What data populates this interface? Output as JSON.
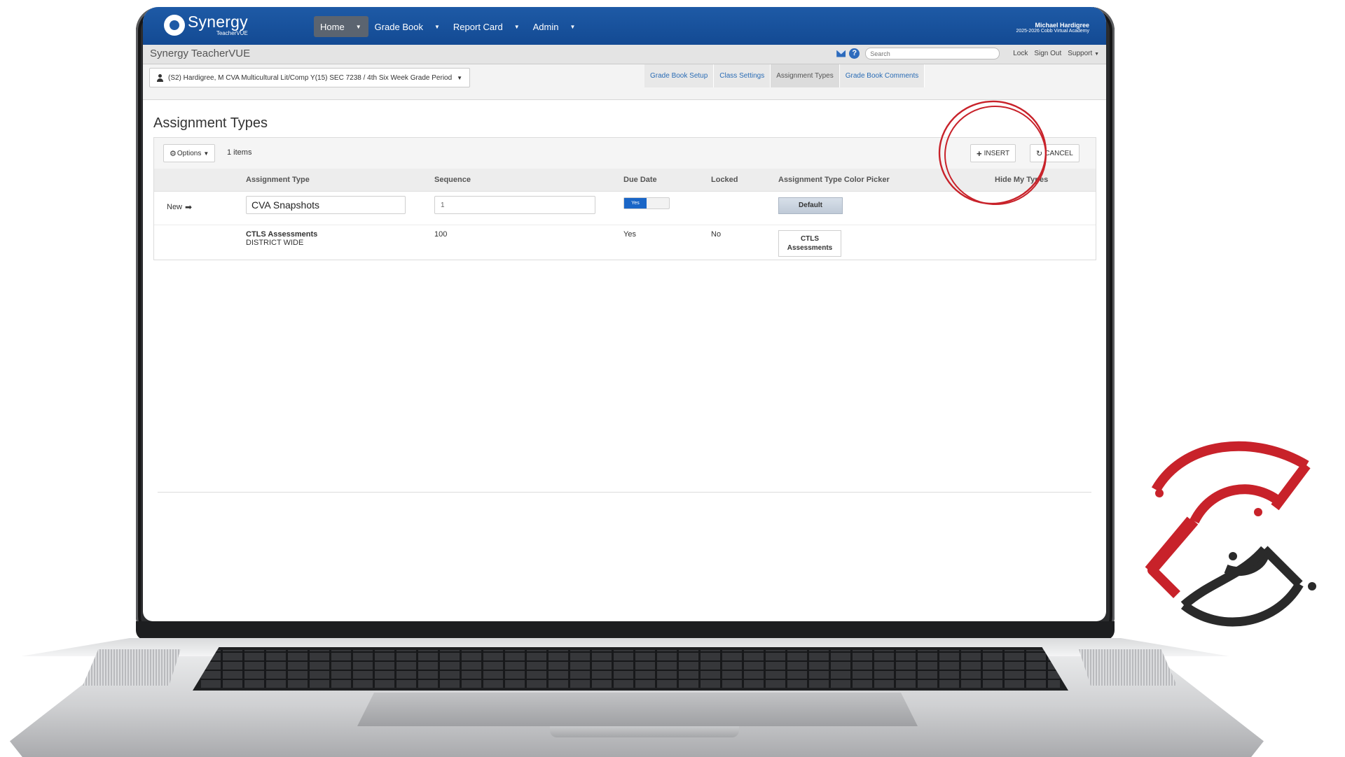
{
  "app": {
    "brand": "Synergy",
    "brand_sub": "TeacherVUE",
    "title": "Synergy TeacherVUE"
  },
  "nav": {
    "items": [
      {
        "label": "Home"
      },
      {
        "label": "Grade Book"
      },
      {
        "label": "Report Card"
      },
      {
        "label": "Admin"
      }
    ]
  },
  "user": {
    "name": "Michael Hardigree",
    "school": "2025-2026 Cobb Virtual Academy"
  },
  "toolbar": {
    "search_placeholder": "Search",
    "lock": "Lock",
    "sign_out": "Sign Out",
    "support": "Support"
  },
  "class_selector": {
    "label": "(S2) Hardigree, M CVA Multicultural Lit/Comp Y(15) SEC 7238 / 4th Six Week Grade Period"
  },
  "tabs": [
    {
      "label": "Grade Book Setup"
    },
    {
      "label": "Class Settings"
    },
    {
      "label": "Assignment Types"
    },
    {
      "label": "Grade Book Comments"
    }
  ],
  "page": {
    "title": "Assignment Types",
    "options_label": "Options",
    "item_count": "1 items",
    "insert_label": "INSERT",
    "cancel_label": "CANCEL"
  },
  "columns": {
    "type": "Assignment Type",
    "sequence": "Sequence",
    "due_date": "Due Date",
    "locked": "Locked",
    "color": "Assignment Type Color Picker",
    "hide": "Hide My Types"
  },
  "new_row": {
    "label": "New",
    "type_value": "CVA Snapshots",
    "sequence_value": "1",
    "due_date_toggle": "Yes",
    "color_button": "Default"
  },
  "rows": [
    {
      "name": "CTLS Assessments",
      "scope": "DISTRICT WIDE",
      "sequence": "100",
      "due_date": "Yes",
      "locked": "No",
      "chip_line1": "CTLS",
      "chip_line2": "Assessments"
    }
  ],
  "colors": {
    "nav_blue": "#1e5aa6",
    "link_blue": "#2a6cb5",
    "toggle_blue": "#1a66c7",
    "annotation_red": "#c8222a",
    "logo_red": "#c8222a",
    "logo_dark": "#2a2a2a"
  }
}
